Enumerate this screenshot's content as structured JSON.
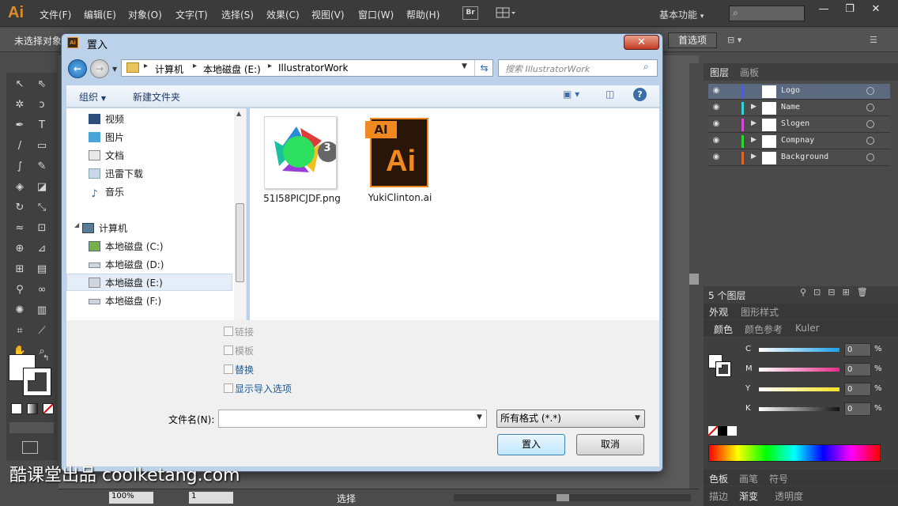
{
  "app": {
    "logo": "Ai",
    "menus": [
      "文件(F)",
      "编辑(E)",
      "对象(O)",
      "文字(T)",
      "选择(S)",
      "效果(C)",
      "视图(V)",
      "窗口(W)",
      "帮助(H)"
    ],
    "bridge_label": "Br",
    "workspace": "基本功能",
    "window_controls": [
      "—",
      "❐",
      "✕"
    ]
  },
  "control_bar": {
    "selection_status": "未选择对象",
    "preferences_button": "首选项"
  },
  "layers_panel": {
    "tabs": [
      "图层",
      "画板"
    ],
    "layers": [
      {
        "name": "Logo",
        "color": "#4a5fd6",
        "selected": true
      },
      {
        "name": "Name",
        "color": "#2ed6d6",
        "selected": false
      },
      {
        "name": "Slogen",
        "color": "#d64ad6",
        "selected": false
      },
      {
        "name": "Compnay",
        "color": "#2ed62e",
        "selected": false
      },
      {
        "name": "Background",
        "color": "#e0642e",
        "selected": false
      }
    ],
    "count_label": "5 个图层"
  },
  "appearance_panel": {
    "tabs": [
      "外观",
      "图形样式"
    ]
  },
  "color_panel": {
    "tabs": [
      "颜色",
      "颜色参考",
      "Kuler"
    ],
    "channels": [
      {
        "label": "C",
        "value": "0",
        "unit": "%"
      },
      {
        "label": "M",
        "value": "0",
        "unit": "%"
      },
      {
        "label": "Y",
        "value": "0",
        "unit": "%"
      },
      {
        "label": "K",
        "value": "0",
        "unit": "%"
      }
    ]
  },
  "bottom_panels": {
    "row1": [
      "色板",
      "画笔",
      "符号"
    ],
    "row2": [
      "描边",
      "渐变",
      "透明度"
    ]
  },
  "status_bar": {
    "zoom": "100%",
    "artboard": "1",
    "tool": "选择"
  },
  "dialog": {
    "title": "置入",
    "breadcrumb": [
      "计算机",
      "本地磁盘 (E:)",
      "IllustratorWork"
    ],
    "search_placeholder": "搜索 IllustratorWork",
    "organize": "组织",
    "new_folder": "新建文件夹",
    "nav_libraries": [
      "视频",
      "图片",
      "文档",
      "迅雷下载",
      "音乐"
    ],
    "nav_computer": "计算机",
    "nav_drives": [
      "本地磁盘 (C:)",
      "本地磁盘 (D:)",
      "本地磁盘 (E:)",
      "本地磁盘 (F:)"
    ],
    "files": [
      {
        "name": "51I58PICJDF.png",
        "badge": "3"
      },
      {
        "name": "YukiClinton.ai",
        "badge_text": "AI",
        "icon_text": "Ai"
      }
    ],
    "options": [
      {
        "label": "链接",
        "enabled": false
      },
      {
        "label": "模板",
        "enabled": false
      },
      {
        "label": "替换",
        "enabled": true
      },
      {
        "label": "显示导入选项",
        "enabled": true
      }
    ],
    "filename_label": "文件名(N):",
    "filename_value": "",
    "filetype": "所有格式 (*.*)",
    "place_button": "置入",
    "cancel_button": "取消"
  },
  "watermark": "酷课堂出品 coolketang.com"
}
